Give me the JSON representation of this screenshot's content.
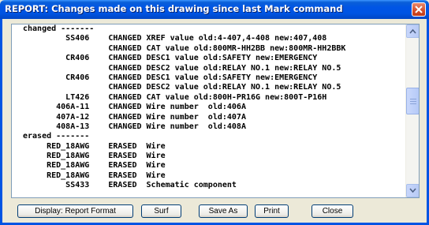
{
  "window": {
    "title": "REPORT: Changes made on this drawing since last Mark command",
    "close_icon": "close-icon"
  },
  "report_lines": [
    "changed -------",
    "         SS406    CHANGED XREF value old:4-407,4-408 new:407,408",
    "                  CHANGED CAT value old:800MR-HH2BB new:800MR-HH2BBK",
    "         CR406    CHANGED DESC1 value old:SAFETY new:EMERGENCY",
    "                  CHANGED DESC2 value old:RELAY NO.1 new:RELAY NO.5",
    "         CR406    CHANGED DESC1 value old:SAFETY new:EMERGENCY",
    "                  CHANGED DESC2 value old:RELAY NO.1 new:RELAY NO.5",
    "         LT426    CHANGED CAT value old:800H-PR16G new:800T-P16H",
    "       406A-11    CHANGED Wire number  old:406A",
    "       407A-12    CHANGED Wire number  old:407A",
    "       408A-13    CHANGED Wire number  old:408A",
    "erased -------",
    "     RED_18AWG    ERASED  Wire",
    "     RED_18AWG    ERASED  Wire",
    "     RED_18AWG    ERASED  Wire",
    "     RED_18AWG    ERASED  Wire",
    "         SS433    ERASED  Schematic component"
  ],
  "scrollbar": {
    "up_icon": "scroll-up-arrow-icon",
    "down_icon": "scroll-down-arrow-icon"
  },
  "buttons": {
    "display_format": "Display: Report Format",
    "surf": "Surf",
    "save_as": "Save As",
    "print": "Print",
    "close": "Close"
  }
}
